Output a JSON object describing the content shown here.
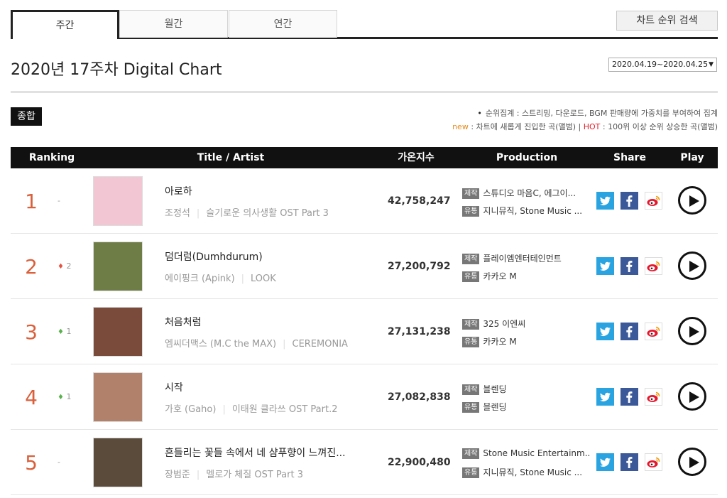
{
  "tabs": [
    "주간",
    "월간",
    "연간"
  ],
  "search_button": "차트 순위 검색",
  "heading": "2020년 17주차 Digital Chart",
  "date_range": "2020.04.19~2020.04.25",
  "total_badge": "종합",
  "notes": {
    "bullet": "•",
    "line1": "순위집계 : 스트리밍, 다운로드, BGM 판매량에 가중치를 부여하여 집계",
    "new_label": "new",
    "new_desc": " : 차트에 새롭게 진입한 곡(앨범) | ",
    "hot_label": "HOT",
    "hot_desc": " : 100위 이상 순위 상승한 곡(앨범)"
  },
  "columns": {
    "ranking": "Ranking",
    "title_artist": "Title / Artist",
    "count": "가온지수",
    "production": "Production",
    "share": "Share",
    "play": "Play"
  },
  "tags": {
    "produce": "제작",
    "distribute": "유통"
  },
  "rows": [
    {
      "rank": "1",
      "change_symbol": "",
      "change": "-",
      "title": "아로하",
      "artist": "조정석",
      "album": "슬기로운 의사생활 OST Part 3",
      "count": "42,758,247",
      "producer": "스튜디오 마음C, 에그이...",
      "distributor": "지니뮤직, Stone Music ...",
      "cover_color": "#f3c6d3"
    },
    {
      "rank": "2",
      "change_symbol": "♦",
      "change": "2",
      "title": "덤더럼(Dumhdurum)",
      "artist": "에이핑크 (Apink)",
      "album": "LOOK",
      "count": "27,200,792",
      "producer": "플레이엠엔터테인먼트",
      "distributor": "카카오 M",
      "cover_color": "#6e7d45"
    },
    {
      "rank": "3",
      "change_symbol": "♦",
      "change": "1",
      "title": "처음처럼",
      "artist": "엠씨더맥스 (M.C the MAX)",
      "album": "CEREMONIA",
      "count": "27,131,238",
      "producer": "325 이엔씨",
      "distributor": "카카오 M",
      "cover_color": "#7a4a3a"
    },
    {
      "rank": "4",
      "change_symbol": "♦",
      "change": "1",
      "title": "시작",
      "artist": "가호 (Gaho)",
      "album": "이태원 클라쓰 OST Part.2",
      "count": "27,082,838",
      "producer": "블렌딩",
      "distributor": "블렌딩",
      "cover_color": "#b2816b"
    },
    {
      "rank": "5",
      "change_symbol": "",
      "change": "-",
      "title": "흔들리는 꽃들 속에서 네 샴푸향이 느껴진...",
      "artist": "장범준",
      "album": "멜로가 체질 OST Part 3",
      "count": "22,900,480",
      "producer": "Stone Music Entertainm...",
      "distributor": "지니뮤직, Stone Music ...",
      "cover_color": "#5b4b3b"
    }
  ],
  "icons": {
    "twitter": "twitter-icon",
    "facebook": "facebook-icon",
    "weibo": "weibo-icon",
    "play": "play-icon"
  }
}
